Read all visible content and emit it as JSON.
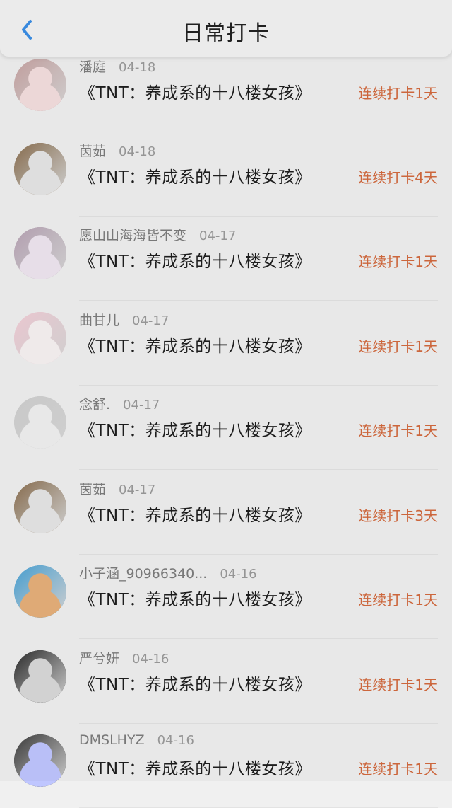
{
  "header": {
    "title": "日常打卡",
    "back_icon": "chevron-left-icon",
    "accent": "#3a8ee6"
  },
  "colors": {
    "streak": "#d36a3e"
  },
  "items": [
    {
      "name": "潘庭",
      "date": "04-18",
      "book": "《TNT：养成系的十八楼女孩》",
      "streak": "连续打卡1天",
      "avatar": {
        "bg": "#c7a3a2",
        "face": "#f4dede"
      }
    },
    {
      "name": "茵茹",
      "date": "04-18",
      "book": "《TNT：养成系的十八楼女孩》",
      "streak": "连续打卡4天",
      "avatar": {
        "bg": "#8a6f50",
        "face": "#e6e6e6"
      }
    },
    {
      "name": "愿山山海海皆不变",
      "date": "04-17",
      "book": "《TNT：养成系的十八楼女孩》",
      "streak": "连续打卡1天",
      "avatar": {
        "bg": "#b7a3b4",
        "face": "#efe6f0"
      }
    },
    {
      "name": "曲甘儿",
      "date": "04-17",
      "book": "《TNT：养成系的十八楼女孩》",
      "streak": "连续打卡1天",
      "avatar": {
        "bg": "#f2cdd6",
        "face": "#f7f2f2"
      }
    },
    {
      "name": "念舒.",
      "date": "04-17",
      "book": "《TNT：养成系的十八楼女孩》",
      "streak": "连续打卡1天",
      "avatar": {
        "bg": "#cfcfcf",
        "face": "#f0f0f0"
      }
    },
    {
      "name": "茵茹",
      "date": "04-17",
      "book": "《TNT：养成系的十八楼女孩》",
      "streak": "连续打卡3天",
      "avatar": {
        "bg": "#8a6f50",
        "face": "#e6e6e6"
      }
    },
    {
      "name": "小子涵_90966340...",
      "date": "04-16",
      "book": "《TNT：养成系的十八楼女孩》",
      "streak": "连续打卡1天",
      "avatar": {
        "bg": "#4aa3d6",
        "face": "#e7b07a"
      }
    },
    {
      "name": "严兮妍",
      "date": "04-16",
      "book": "《TNT：养成系的十八楼女孩》",
      "streak": "连续打卡1天",
      "avatar": {
        "bg": "#2b2b2b",
        "face": "#d9d9d9"
      }
    },
    {
      "name": "DMSLHYZ",
      "date": "04-16",
      "book": "《TNT：养成系的十八楼女孩》",
      "streak": "连续打卡1天",
      "avatar": {
        "bg": "#3b3b3b",
        "face": "#bfc6ff"
      }
    }
  ]
}
